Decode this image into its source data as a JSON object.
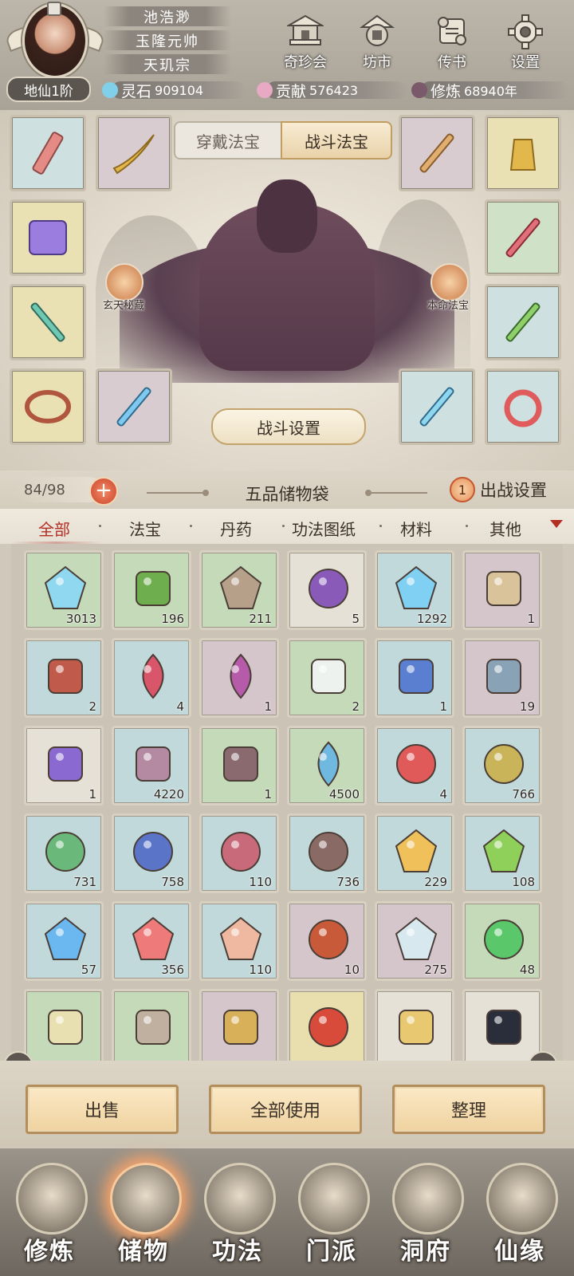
{
  "header": {
    "player_name": "池浩渺",
    "title": "玉隆元帅",
    "sect": "天玑宗",
    "rank": "地仙1阶",
    "menu": [
      {
        "label": "奇珍会",
        "icon": "pavilion-icon"
      },
      {
        "label": "坊市",
        "icon": "market-icon"
      },
      {
        "label": "传书",
        "icon": "scroll-letter-icon"
      },
      {
        "label": "设置",
        "icon": "gear-icon"
      }
    ],
    "resources": [
      {
        "name": "灵石",
        "value": "909104",
        "color": "#7fd0e8"
      },
      {
        "name": "贡献",
        "value": "576423",
        "color": "#e7a9c4"
      },
      {
        "name": "修炼",
        "value": "68940年",
        "color": "#7a5a6a"
      }
    ]
  },
  "equipment": {
    "tabs": [
      {
        "label": "穿戴法宝",
        "active": false
      },
      {
        "label": "战斗法宝",
        "active": true
      }
    ],
    "left_badge": "玄天秘藏",
    "right_badge": "本命法宝",
    "battle_settings": "战斗设置"
  },
  "bag": {
    "capacity": "84/98",
    "title": "五品储物袋",
    "deploy_count": "1",
    "deploy_label": "出战设置"
  },
  "categories": [
    "全部",
    "法宝",
    "丹药",
    "功法图纸",
    "材料",
    "其他"
  ],
  "active_category": "全部",
  "items": [
    {
      "icon": "blue-crystal-icon",
      "qty": "3013",
      "rarity": "green"
    },
    {
      "icon": "herb-sprout-icon",
      "qty": "196",
      "rarity": "green"
    },
    {
      "icon": "ore-rock-icon",
      "qty": "211",
      "rarity": "green"
    },
    {
      "icon": "purple-orb-icon",
      "qty": "5",
      "rarity": "white"
    },
    {
      "icon": "glowing-shard-icon",
      "qty": "1292",
      "rarity": "blue"
    },
    {
      "icon": "treasure-map-icon",
      "qty": "1",
      "rarity": "purple"
    },
    {
      "icon": "wine-jar-icon",
      "qty": "2",
      "rarity": "blue"
    },
    {
      "icon": "red-leaf-icon",
      "qty": "4",
      "rarity": "blue"
    },
    {
      "icon": "purple-leaf-icon",
      "qty": "1",
      "rarity": "purple"
    },
    {
      "icon": "white-lily-icon",
      "qty": "2",
      "rarity": "green"
    },
    {
      "icon": "blue-flower-icon",
      "qty": "1",
      "rarity": "blue"
    },
    {
      "icon": "pearl-cloth-icon",
      "qty": "19",
      "rarity": "purple"
    },
    {
      "icon": "purple-cloth-icon",
      "qty": "1",
      "rarity": "white"
    },
    {
      "icon": "powder-pile-icon",
      "qty": "4220",
      "rarity": "blue"
    },
    {
      "icon": "gourd-icon",
      "qty": "1",
      "rarity": "green"
    },
    {
      "icon": "water-drop-icon",
      "qty": "4500",
      "rarity": "green"
    },
    {
      "icon": "red-pill-icon",
      "qty": "4",
      "rarity": "blue"
    },
    {
      "icon": "gold-pill-icon",
      "qty": "766",
      "rarity": "blue"
    },
    {
      "icon": "green-pill-icon",
      "qty": "731",
      "rarity": "blue"
    },
    {
      "icon": "blue-pill-icon",
      "qty": "758",
      "rarity": "blue"
    },
    {
      "icon": "pink-pill-icon",
      "qty": "110",
      "rarity": "blue"
    },
    {
      "icon": "brown-pill-icon",
      "qty": "736",
      "rarity": "blue"
    },
    {
      "icon": "amber-gem-icon",
      "qty": "229",
      "rarity": "blue"
    },
    {
      "icon": "green-gem-icon",
      "qty": "108",
      "rarity": "blue"
    },
    {
      "icon": "blue-gem-icon",
      "qty": "57",
      "rarity": "blue"
    },
    {
      "icon": "red-gem-icon",
      "qty": "356",
      "rarity": "blue"
    },
    {
      "icon": "peach-gem-icon",
      "qty": "110",
      "rarity": "blue"
    },
    {
      "icon": "fire-orb-icon",
      "qty": "10",
      "rarity": "purple"
    },
    {
      "icon": "ice-crystal-icon",
      "qty": "275",
      "rarity": "purple"
    },
    {
      "icon": "jade-orb-icon",
      "qty": "48",
      "rarity": "green"
    },
    {
      "icon": "bone-icon",
      "qty": "",
      "rarity": "green"
    },
    {
      "icon": "rope-icon",
      "qty": "",
      "rarity": "green"
    },
    {
      "icon": "golden-herb-icon",
      "qty": "",
      "rarity": "purple"
    },
    {
      "icon": "dragon-orb-icon",
      "qty": "",
      "rarity": "yellow"
    },
    {
      "icon": "gold-scroll-icon",
      "qty": "",
      "rarity": "white"
    },
    {
      "icon": "dark-stone-icon",
      "qty": "",
      "rarity": "white"
    }
  ],
  "actions": [
    "出售",
    "全部使用",
    "整理"
  ],
  "nav": [
    {
      "label": "修炼",
      "icon": "meditation-icon",
      "active": false
    },
    {
      "label": "储物",
      "icon": "storage-bag-icon",
      "active": true
    },
    {
      "label": "功法",
      "icon": "manual-book-icon",
      "active": false
    },
    {
      "label": "门派",
      "icon": "sect-gate-icon",
      "active": false
    },
    {
      "label": "洞府",
      "icon": "cave-mountain-icon",
      "active": false
    },
    {
      "label": "仙缘",
      "icon": "fate-swirl-icon",
      "active": false
    }
  ]
}
